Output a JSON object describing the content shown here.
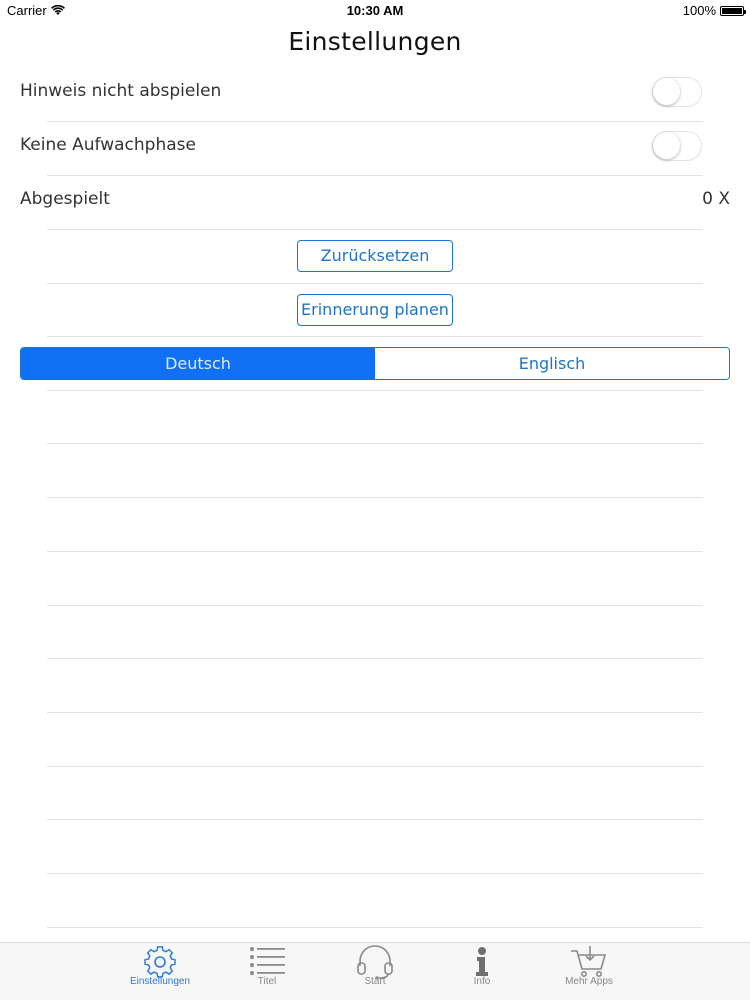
{
  "status_bar": {
    "carrier": "Carrier",
    "time": "10:30 AM",
    "battery": "100%"
  },
  "title": "Einstellungen",
  "settings": {
    "hinweis_label": "Hinweis nicht abspielen",
    "hinweis_on": false,
    "aufwach_label": "Keine Aufwachphase",
    "aufwach_on": false,
    "abgespielt_label": "Abgespielt",
    "abgespielt_value": "0 X",
    "reset_label": "Zurücksetzen",
    "reminder_label": "Erinnerung planen"
  },
  "language": {
    "options": [
      "Deutsch",
      "Englisch"
    ],
    "selected": "Deutsch"
  },
  "tabs": [
    {
      "label": "Einstellungen",
      "icon": "gear-icon",
      "active": true
    },
    {
      "label": "Titel",
      "icon": "list-icon",
      "active": false
    },
    {
      "label": "Start",
      "icon": "headphones-icon",
      "active": false
    },
    {
      "label": "Info",
      "icon": "info-icon",
      "active": false
    },
    {
      "label": "Mehr Apps",
      "icon": "cart-icon",
      "active": false
    }
  ],
  "colors": {
    "accent": "#1E74C8",
    "segment_selected": "#1070F5",
    "tab_active": "#2A7BD4",
    "tab_inactive": "#888888"
  }
}
